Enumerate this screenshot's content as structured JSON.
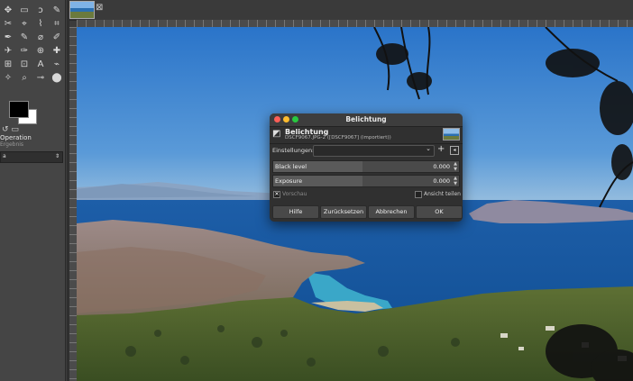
{
  "toolbox": {
    "operation_label": "Operation",
    "operation_sub": "Ergebnis",
    "combo_value": "a",
    "combo_arrow": "⇕"
  },
  "tabstrip": {
    "close_glyph": "⊠"
  },
  "dialog": {
    "title": "Belichtung",
    "header_title": "Belichtung",
    "header_subtitle": "DSCF9067.JPG-2 ([DSCF9067] (importiert))",
    "presets_label": "Einstellungen:",
    "presets_value": "",
    "params": [
      {
        "label": "Black level",
        "value": "0.000",
        "fraction": 0.48
      },
      {
        "label": "Exposure",
        "value": "0.000",
        "fraction": 0.48
      }
    ],
    "preview_label": "Vorschau",
    "preview_checked": true,
    "split_label": "Ansicht teilen",
    "split_checked": false,
    "buttons": {
      "help": "Hilfe",
      "reset": "Zurücksetzen",
      "cancel": "Abbrechen",
      "ok": "OK"
    }
  },
  "icons": {
    "tools": [
      "move-icon",
      "rect-select-icon",
      "lasso-icon",
      "fuzzy-select-icon",
      "crop-icon",
      "unified-transform-icon",
      "warp-icon",
      "cage-icon",
      "paint-icon",
      "pencil-icon",
      "brush-icon",
      "eraser-icon",
      "airbrush-icon",
      "ink-icon",
      "clone-icon",
      "heal-icon",
      "smudge-icon",
      "dodge-icon",
      "text-icon",
      "path-icon",
      "color-picker-icon",
      "zoom-icon",
      "measure-icon",
      "bucket-icon"
    ],
    "tool_glyphs": [
      "✥",
      "▭",
      "ↄ",
      "✎",
      "✂",
      "⌖",
      "⌇",
      "⌗",
      "✒",
      "✎",
      "⌀",
      "✐",
      "✈",
      "✑",
      "⊕",
      "✚",
      "⊞",
      "⊡",
      "A",
      "⌁",
      "✧",
      "⌕",
      "⊸",
      "⬤"
    ]
  },
  "colors": {
    "accent_blue": "#2f6fb8",
    "dialog_bg": "#303030",
    "toolbox_bg": "#454545"
  }
}
